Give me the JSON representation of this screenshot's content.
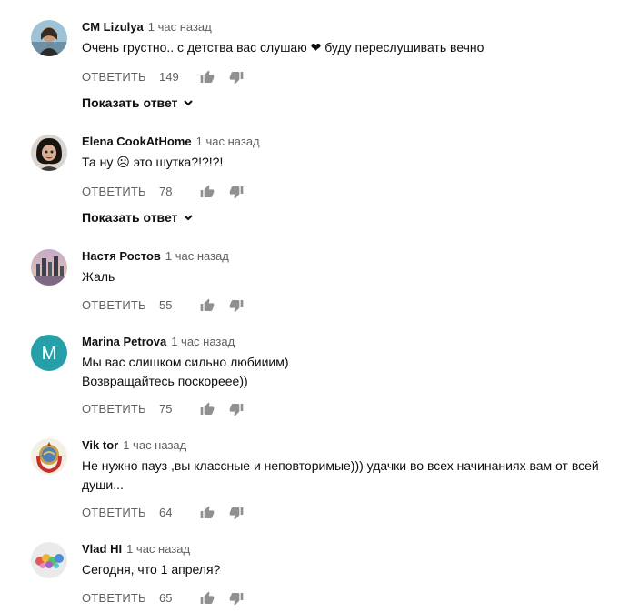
{
  "comments": [
    {
      "author": "СМ Lizulya",
      "time": "1 час назад",
      "text": [
        "Очень грустно.. с детства вас слушаю ❤ буду переслушивать вечно"
      ],
      "reply_label": "ОТВЕТИТЬ",
      "likes": "149",
      "show_replies": "Показать ответ"
    },
    {
      "author": "Elena CookAtHome",
      "time": "1 час назад",
      "text": [
        "Та ну ☹ это шутка?!?!?!"
      ],
      "reply_label": "ОТВЕТИТЬ",
      "likes": "78",
      "show_replies": "Показать ответ"
    },
    {
      "author": "Настя Ростов",
      "time": "1 час назад",
      "text": [
        "Жаль"
      ],
      "reply_label": "ОТВЕТИТЬ",
      "likes": "55"
    },
    {
      "author": "Marina Petrova",
      "time": "1 час назад",
      "text": [
        "Мы вас слишком сильно любииим)",
        "Возвращайтесь поскорееe))"
      ],
      "reply_label": "ОТВЕТИТЬ",
      "likes": "75",
      "avatar_letter": "M",
      "avatar_color": "#26a0a8"
    },
    {
      "author": "Vik tor",
      "time": "1 час назад",
      "text": [
        "Не нужно пауз ,вы классные и неповторимые))) удачки во всех начинаниях вам от всей",
        "души..."
      ],
      "reply_label": "ОТВЕТИТЬ",
      "likes": "64"
    },
    {
      "author": "Vlad HI",
      "time": "1 час назад",
      "text": [
        "Сегодня, что 1 апреля?"
      ],
      "reply_label": "ОТВЕТИТЬ",
      "likes": "65"
    }
  ],
  "icons": {
    "like": "thumb-up-icon",
    "dislike": "thumb-down-icon",
    "chevron": "chevron-down-icon"
  },
  "colors": {
    "meta_gray": "#606060",
    "icon_gray": "#909090",
    "text": "#0d0d0d"
  }
}
